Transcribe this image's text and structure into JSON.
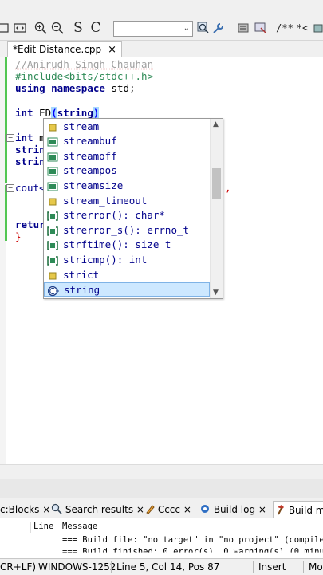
{
  "toolbar": {
    "select_icon_label": "S",
    "clear_icon_label": "C",
    "combo_value": "",
    "combo_arrow": "⌄",
    "comment_label": "/**",
    "star_label": "*<"
  },
  "tabs": [
    {
      "label": "*Edit Distance.cpp",
      "close": "×"
    }
  ],
  "code": {
    "line1": "//Anirudh Singh Chauhan",
    "line2": "#include<bits/stdc++.h>",
    "line3_kw1": "using namespace",
    "line3_rest": " std;",
    "line5_kw": "int",
    "line5_name": " ED",
    "line5_paren_open": "(",
    "line5_arg": "string",
    "line5_paren_close": ")",
    "line7_kw": "int",
    "line7_rest": " m",
    "line8": "strin",
    "line9": "strin",
    "line11": "cout<",
    "line11_tail": ",",
    "line13": "retur",
    "line14": "}"
  },
  "autocomplete": {
    "items": [
      {
        "text": "stream",
        "icon": "typedef-icon"
      },
      {
        "text": "streambuf",
        "icon": "class-icon"
      },
      {
        "text": "streamoff",
        "icon": "class-icon"
      },
      {
        "text": "streampos",
        "icon": "class-icon"
      },
      {
        "text": "streamsize",
        "icon": "class-icon"
      },
      {
        "text": "stream_timeout",
        "icon": "typedef-icon"
      },
      {
        "text": "strerror(): char*",
        "icon": "function-icon"
      },
      {
        "text": "strerror_s(): errno_t",
        "icon": "function-icon"
      },
      {
        "text": "strftime(): size_t",
        "icon": "function-icon"
      },
      {
        "text": "stricmp(): int",
        "icon": "function-icon"
      },
      {
        "text": "strict",
        "icon": "typedef-icon"
      },
      {
        "text": "string",
        "icon": "class-plus-icon"
      }
    ],
    "selected_index": 11
  },
  "logtabs": [
    {
      "label": "c:Blocks",
      "close": "×"
    },
    {
      "label": "Search results",
      "close": "×"
    },
    {
      "label": "Cccc",
      "close": "×"
    },
    {
      "label": "Build log",
      "close": "×"
    },
    {
      "label": "Build me",
      "close": ""
    }
  ],
  "log": {
    "col_line": "Line",
    "col_message": "Message",
    "row1": "=== Build file: \"no target\" in \"no project\" (compiler",
    "row2": "=== Build finished: 0 error(s), 0 warning(s) (0 minu"
  },
  "status": {
    "eol": "CR+LF)",
    "encoding": "WINDOWS-1252",
    "position": "Line 5, Col 14, Pos 87",
    "mode": "Insert",
    "more": "Mo"
  },
  "colors": {
    "keyword": "#00008b",
    "preprocessor": "#2e8b57",
    "comment": "#a0a0a0",
    "selection": "#cde8ff",
    "class_icon": "#2e8b57"
  }
}
